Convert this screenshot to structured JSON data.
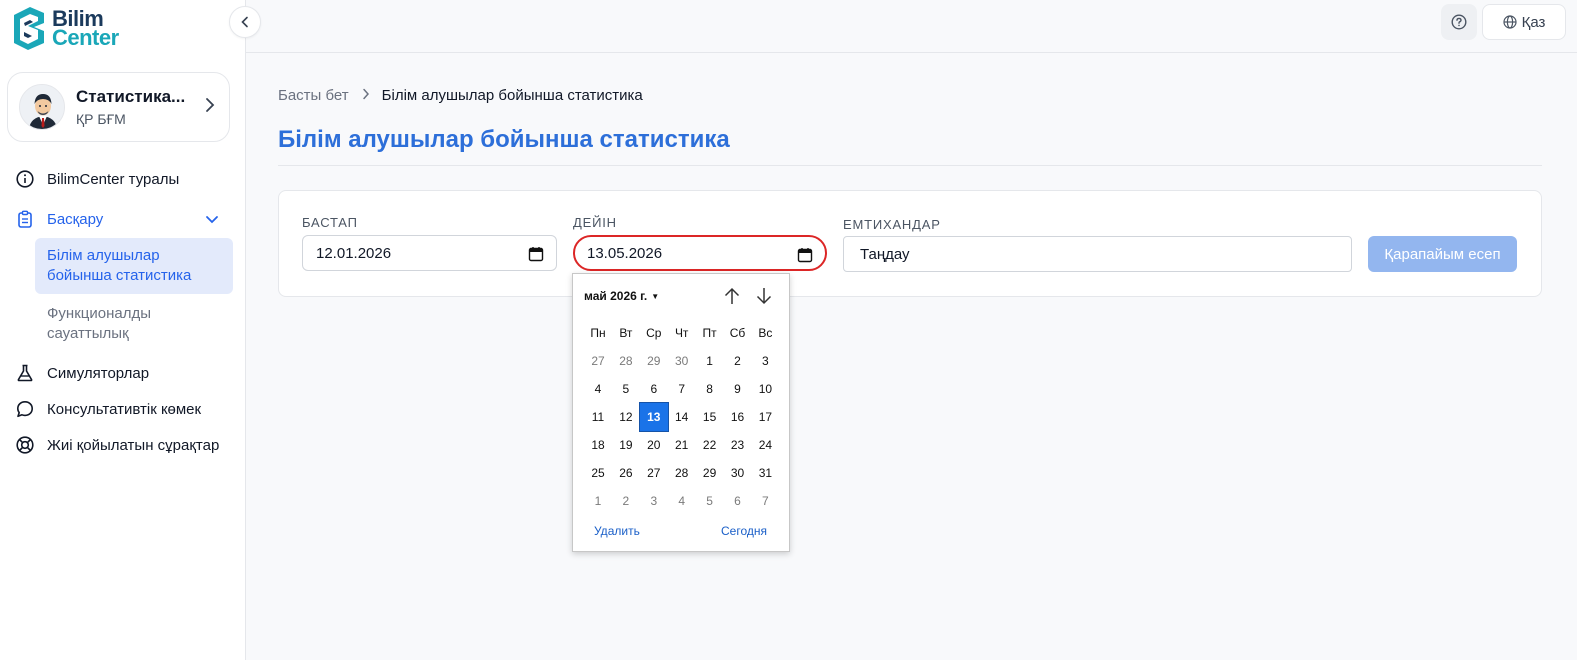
{
  "brand": {
    "line1": "Bilim",
    "line2": "Center"
  },
  "profile": {
    "name": "Статистика...",
    "org": "ҚР БҒМ"
  },
  "nav": {
    "about": "BilimCenter туралы",
    "manage": "Басқару",
    "sub_stats": "Білім алушылар бойынша статистика",
    "sub_literacy": "Функционалды сауаттылық",
    "simulators": "Симуляторлар",
    "consult": "Консультативтік көмек",
    "faq": "Жиі қойылатын сұрақтар"
  },
  "header": {
    "lang": "Қаз"
  },
  "breadcrumb": {
    "home": "Басты бет",
    "current": "Білім алушылар бойынша статистика"
  },
  "page_title": "Білім алушылар бойынша статистика",
  "filters": {
    "from_label": "БАСТАП",
    "from_value": "12.01.2026",
    "to_label": "ДЕЙІН",
    "to_value": "13.05.2026",
    "exams_label": "ЕМТИХАНДАР",
    "exams_value": "Таңдау",
    "report_button": "Қарапайым есеп"
  },
  "datepicker": {
    "month": "май 2026 г.",
    "weekdays": [
      "Пн",
      "Вт",
      "Ср",
      "Чт",
      "Пт",
      "Сб",
      "Вс"
    ],
    "weeks": [
      [
        "27",
        "28",
        "29",
        "30",
        "1",
        "2",
        "3"
      ],
      [
        "4",
        "5",
        "6",
        "7",
        "8",
        "9",
        "10"
      ],
      [
        "11",
        "12",
        "13",
        "14",
        "15",
        "16",
        "17"
      ],
      [
        "18",
        "19",
        "20",
        "21",
        "22",
        "23",
        "24"
      ],
      [
        "25",
        "26",
        "27",
        "28",
        "29",
        "30",
        "31"
      ],
      [
        "1",
        "2",
        "3",
        "4",
        "5",
        "6",
        "7"
      ]
    ],
    "selected_day": "13",
    "clear": "Удалить",
    "today": "Сегодня"
  },
  "colors": {
    "accent": "#2563eb",
    "title": "#2d6fd9",
    "focus_ring": "#dc2626",
    "selected_day": "#1a73e8"
  }
}
